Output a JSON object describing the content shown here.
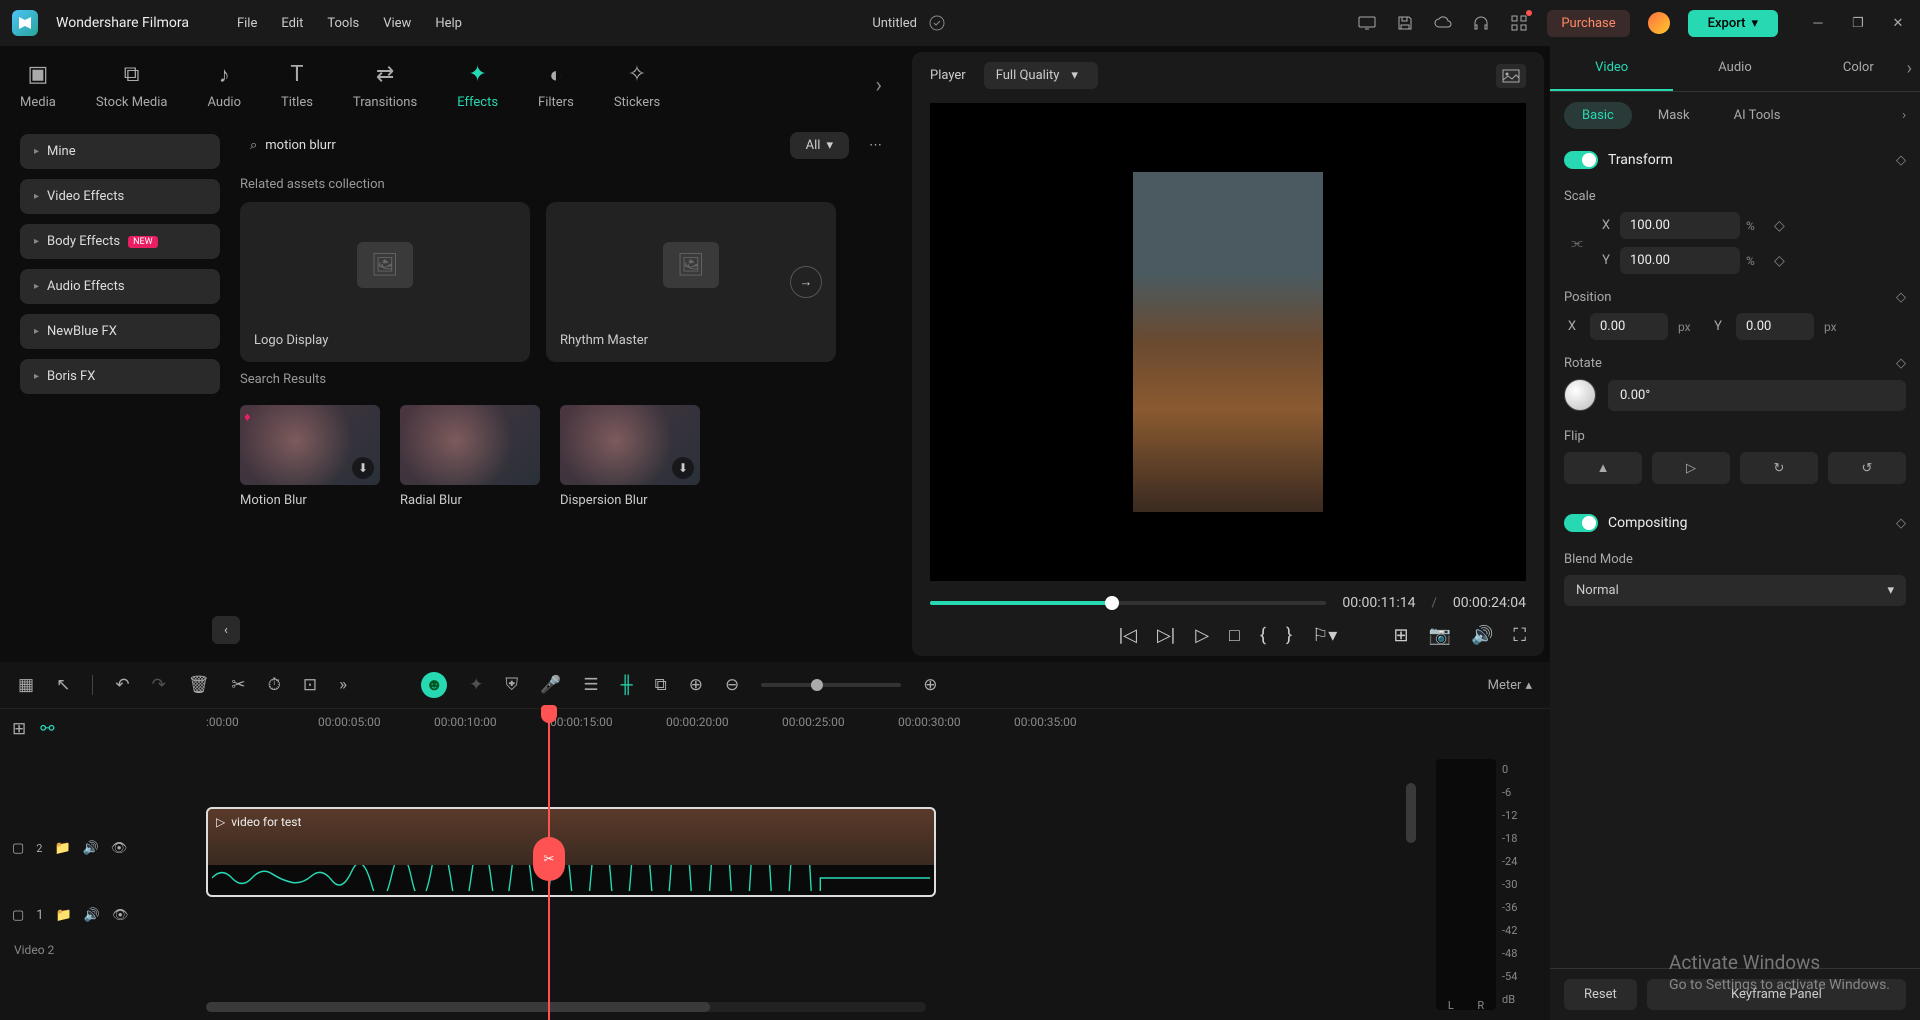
{
  "app": {
    "title": "Wondershare Filmora",
    "doc": "Untitled"
  },
  "menus": [
    "File",
    "Edit",
    "Tools",
    "View",
    "Help"
  ],
  "titleright": {
    "purchase": "Purchase",
    "export": "Export"
  },
  "ribbon": [
    {
      "label": "Media"
    },
    {
      "label": "Stock Media"
    },
    {
      "label": "Audio"
    },
    {
      "label": "Titles"
    },
    {
      "label": "Transitions"
    },
    {
      "label": "Effects",
      "active": true
    },
    {
      "label": "Filters"
    },
    {
      "label": "Stickers"
    }
  ],
  "sidebar": [
    {
      "label": "Mine"
    },
    {
      "label": "Video Effects"
    },
    {
      "label": "Body Effects",
      "new": true
    },
    {
      "label": "Audio Effects"
    },
    {
      "label": "NewBlue FX"
    },
    {
      "label": "Boris FX"
    }
  ],
  "search": {
    "query": "motion blurr",
    "filter": "All"
  },
  "sections": {
    "related": "Related assets collection",
    "cards": [
      {
        "label": "Logo Display"
      },
      {
        "label": "Rhythm Master"
      }
    ],
    "results_label": "Search Results",
    "results": [
      {
        "label": "Motion Blur",
        "diamond": true,
        "dl": true
      },
      {
        "label": "Radial Blur"
      },
      {
        "label": "Dispersion Blur",
        "dl": true
      }
    ]
  },
  "preview": {
    "player": "Player",
    "quality": "Full Quality",
    "cur": "00:00:11:14",
    "sep": "/",
    "dur": "00:00:24:04"
  },
  "inspector": {
    "tabs1": [
      "Video",
      "Audio",
      "Color"
    ],
    "active1": 0,
    "tabs2": [
      "Basic",
      "Mask",
      "AI Tools"
    ],
    "active2": 0,
    "transform": "Transform",
    "scale": "Scale",
    "position": "Position",
    "rotate": "Rotate",
    "flip": "Flip",
    "compositing": "Compositing",
    "blendmode_label": "Blend Mode",
    "blendmode": "Normal",
    "scaleX": "100.00",
    "scaleY": "100.00",
    "posX": "0.00",
    "posY": "0.00",
    "rotVal": "0.00°",
    "X": "X",
    "Y": "Y",
    "pct": "%",
    "px": "px",
    "reset": "Reset",
    "keyframe": "Keyframe Panel"
  },
  "timeline": {
    "meter": "Meter",
    "ticks": [
      ":00:00",
      "00:00:05:00",
      "00:00:10:00",
      "00:00:15:00",
      "00:00:20:00",
      "00:00:25:00",
      "00:00:30:00",
      "00:00:35:00"
    ],
    "clip": "video for test",
    "trackHead1": "2",
    "track2id": "1",
    "trackName": "Video 2",
    "L": "L",
    "R": "R",
    "dB": "dB",
    "scale": [
      "0",
      "-6",
      "-12",
      "-18",
      "-24",
      "-30",
      "-36",
      "-42",
      "-48",
      "-54"
    ]
  },
  "activate": {
    "t1": "Activate Windows",
    "t2": "Go to Settings to activate Windows."
  }
}
